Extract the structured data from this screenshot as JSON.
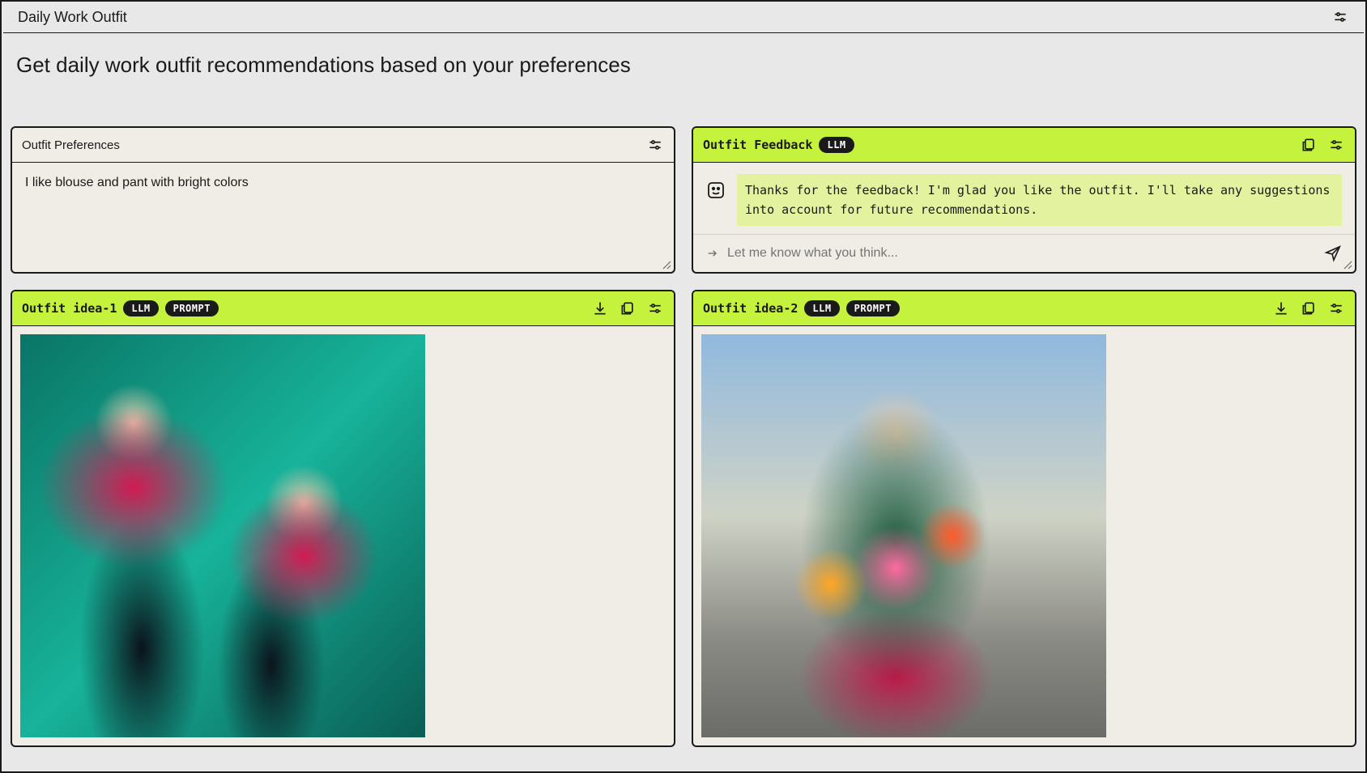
{
  "header": {
    "title": "Daily Work Outfit"
  },
  "subtitle": "Get daily work outfit recommendations based on your preferences",
  "preferences": {
    "title": "Outfit Preferences",
    "text": "I like blouse and pant with bright colors"
  },
  "feedback": {
    "title": "Outfit Feedback",
    "llm_pill": "LLM",
    "message": "Thanks for the feedback! I'm glad you like the outfit. I'll take any suggestions into account for future recommendations.",
    "input_placeholder": "Let me know what you think..."
  },
  "outfit1": {
    "title": "Outfit idea-1",
    "llm_pill": "LLM",
    "prompt_pill": "PROMPT"
  },
  "outfit2": {
    "title": "Outfit idea-2",
    "llm_pill": "LLM",
    "prompt_pill": "PROMPT"
  }
}
